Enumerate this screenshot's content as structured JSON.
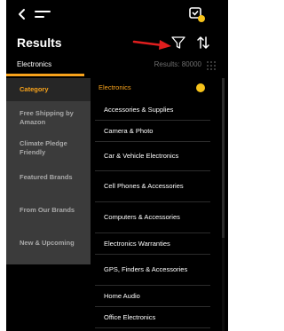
{
  "topbar": {
    "back_icon": "back-arrow-icon",
    "menu_icon": "menu-icon",
    "cart_icon": "cart-check-icon"
  },
  "header": {
    "title": "Results",
    "filter_icon": "filter-icon",
    "sort_icon": "sort-icon",
    "annotation_icon": "red-arrow-icon"
  },
  "search": {
    "term": "Electronics",
    "count": "Results: 80000"
  },
  "filters": {
    "left": [
      {
        "label": "Category",
        "active": true
      },
      {
        "label": "Free Shipping by Amazon",
        "active": false
      },
      {
        "label": "Climate Pledge Friendly",
        "active": false
      },
      {
        "label": "Featured Brands",
        "active": false
      },
      {
        "label": "From Our Brands",
        "active": false
      },
      {
        "label": "New & Upcoming",
        "active": false
      }
    ],
    "selected": "Electronics",
    "items": [
      "Accessories & Supplies",
      "Camera & Photo",
      "Car & Vehicle Electronics",
      "Cell Phones & Accessories",
      "Computers & Accessories",
      "Electronics Warranties",
      "GPS, Finders & Accessories",
      "Home Audio",
      "Office Electronics"
    ]
  },
  "colors": {
    "accent": "#f7a21b",
    "background": "#000000",
    "panel": "#3b3b3b",
    "annotation": "#e01e1e"
  }
}
